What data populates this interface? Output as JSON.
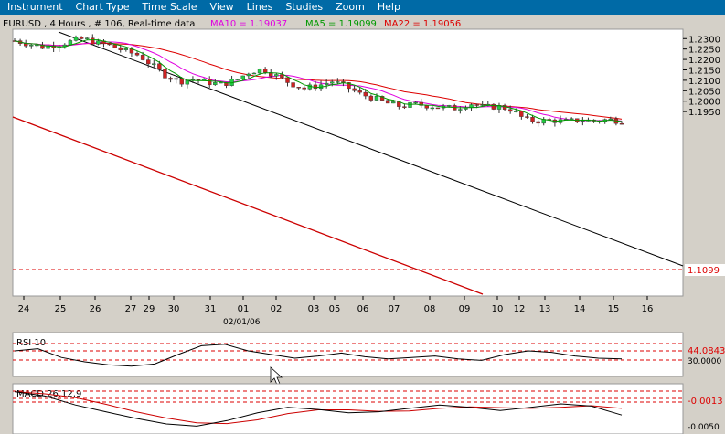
{
  "menu": [
    "Instrument",
    "Chart Type",
    "Time Scale",
    "View",
    "Lines",
    "Studies",
    "Zoom",
    "Help"
  ],
  "chart_header": {
    "info": "EURUSD , 4 Hours , # 106, Real-time data",
    "ma10": "MA10 = 1.19037",
    "ma5": "MA5 = 1.19099",
    "ma22": "MA22 = 1.19056"
  },
  "colors": {
    "menu_bg": "#006aa6",
    "ma10": "#e000e0",
    "ma5": "#009900",
    "ma22": "#dd0000",
    "bull": "#22cc44",
    "bear": "#cc2222",
    "trend": "#000000",
    "channel": "#cc0000"
  },
  "price_axis": [
    "1.2300",
    "1.2250",
    "1.2200",
    "1.2150",
    "1.2100",
    "1.2050",
    "1.2000",
    "1.1950"
  ],
  "current_price": "1.1099",
  "date_axis": [
    "24",
    "25",
    "26",
    "27",
    "29",
    "30",
    "31",
    "01",
    "02",
    "03",
    "05",
    "06",
    "07",
    "08",
    "09",
    "10",
    "12",
    "13",
    "14",
    "15",
    "16"
  ],
  "date_sub": "02/01/06",
  "rsi": {
    "label": "RSI 10",
    "value": "44.0843",
    "level": "30.0000"
  },
  "macd": {
    "label": "MACD 26,12,9",
    "value": "-0.0013",
    "level": "-0.0050"
  },
  "chart_data": {
    "type": "candlestick",
    "symbol": "EURUSD",
    "timeframe": "4 Hours",
    "ylim": [
      1.1065,
      1.2345
    ],
    "x_categories": [
      "24",
      "25",
      "26",
      "27",
      "29",
      "30",
      "31",
      "01",
      "02",
      "03",
      "05",
      "06",
      "07",
      "08",
      "09",
      "10",
      "12",
      "13",
      "14",
      "15",
      "16"
    ],
    "close_path": [
      1.229,
      1.2275,
      1.226,
      1.227,
      1.2285,
      1.23,
      1.2278,
      1.2265,
      1.224,
      1.222,
      1.217,
      1.212,
      1.2095,
      1.2105,
      1.209,
      1.208,
      1.21,
      1.214,
      1.2155,
      1.212,
      1.2085,
      1.206,
      1.2075,
      1.2095,
      1.207,
      1.2035,
      1.2015,
      1.199,
      1.1975,
      1.1985,
      1.1978,
      1.197,
      1.1965,
      1.199,
      1.197,
      1.1975,
      1.196,
      1.191,
      1.1905,
      1.1908,
      1.1902,
      1.191,
      1.1905,
      1.1912,
      1.1905
    ],
    "ma10_last": 1.19037,
    "ma5_last": 1.19099,
    "ma22_last": 1.19056,
    "rsi_path": [
      55,
      58,
      46,
      40,
      36,
      34,
      37,
      50,
      62,
      64,
      55,
      50,
      45,
      48,
      52,
      47,
      44,
      46,
      48,
      44,
      42,
      50,
      55,
      53,
      48,
      45,
      44.08
    ],
    "macd_path": [
      0.0008,
      0.0004,
      -0.0004,
      -0.001,
      -0.0016,
      -0.0021,
      -0.0023,
      -0.0018,
      -0.0011,
      -0.0006,
      -0.0008,
      -0.0011,
      -0.001,
      -0.0007,
      -0.0004,
      -0.0006,
      -0.0009,
      -0.0006,
      -0.0003,
      -0.0005,
      -0.0013
    ]
  }
}
